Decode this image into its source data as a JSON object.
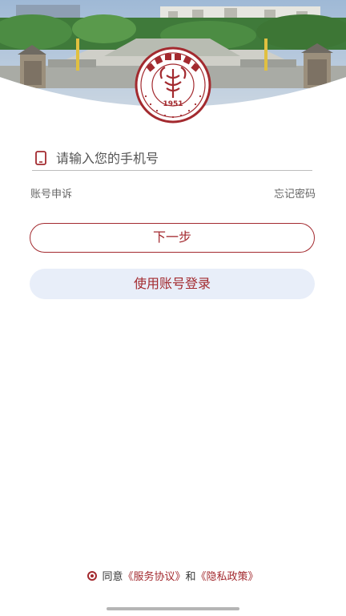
{
  "logo": {
    "name_cn": "山東第二醫科大學",
    "name_en": "SHANDONG SECOND MEDICAL UNIVERSITY",
    "year": "1951"
  },
  "login": {
    "phone_placeholder": "请输入您的手机号",
    "phone_value": "",
    "appeal_link": "账号申诉",
    "forgot_link": "忘记密码",
    "next_button": "下一步",
    "account_login_button": "使用账号登录"
  },
  "agreement": {
    "prefix": "同意",
    "service_link": "《服务协议》",
    "conjunction": "和",
    "privacy_link": "《隐私政策》",
    "checked": true
  },
  "colors": {
    "accent": "#a32a2f",
    "secondary_button_bg": "#e8eef9"
  }
}
